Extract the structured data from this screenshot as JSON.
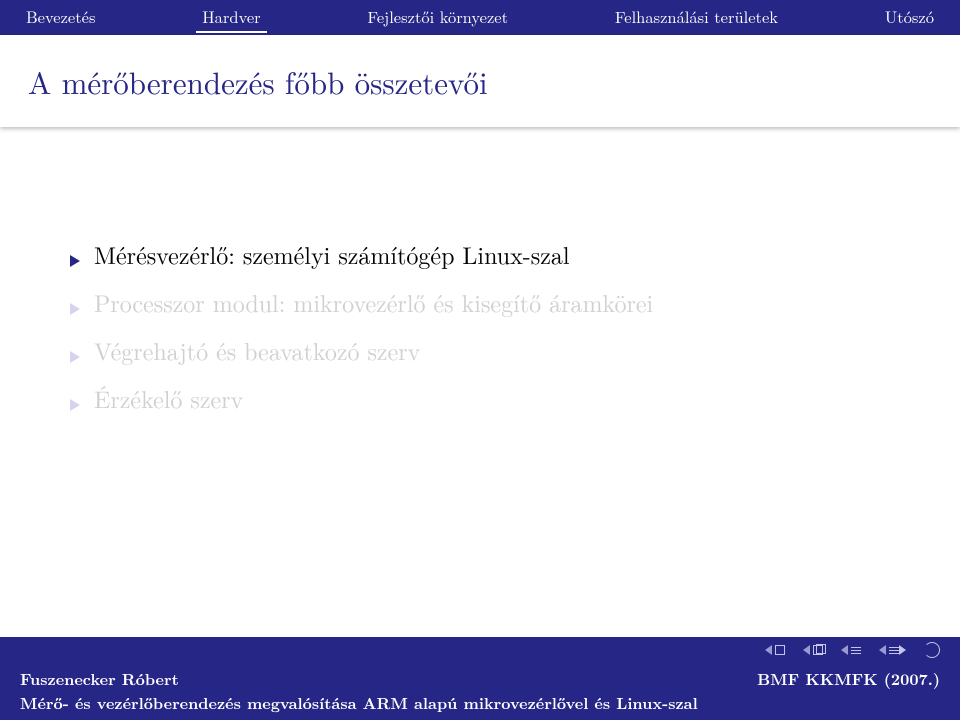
{
  "nav": {
    "items": [
      {
        "label": "Bevezetés"
      },
      {
        "label": "Hardver"
      },
      {
        "label": "Fejlesztői környezet"
      },
      {
        "label": "Felhasználási területek"
      },
      {
        "label": "Utószó"
      }
    ],
    "active_index": 1
  },
  "title": "A mérőberendezés főbb összetevői",
  "bullets": [
    {
      "text": "Mérésvezérlő: személyi számítógép Linux-szal",
      "revealed": true
    },
    {
      "text": "Processzor modul: mikrovezérlő és kisegítő áramkörei",
      "revealed": false
    },
    {
      "text": "Végrehajtó és beavatkozó szerv",
      "revealed": false
    },
    {
      "text": "Érzékelő szerv",
      "revealed": false
    }
  ],
  "footer": {
    "author": "Fuszenecker Róbert",
    "institute": "BMF KKMFK (2007.)",
    "subtitle": "Mérő- és vezérlőberendezés megvalósítása ARM alapú mikrovezérlővel és Linux-szal"
  }
}
